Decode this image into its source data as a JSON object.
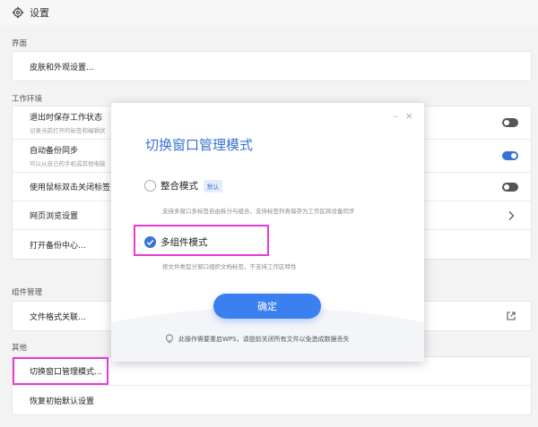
{
  "titlebar": {
    "title": "设置",
    "icon": "gear-icon"
  },
  "sections": {
    "interface": "界面",
    "workspace": "工作环境",
    "components": "组件管理",
    "other": "其他"
  },
  "interface_rows": [
    {
      "label": "皮肤和外观设置..."
    }
  ],
  "workspace_rows": [
    {
      "label": "退出时保存工作状态",
      "sub": "记录当前打开的标签和编辑状",
      "toggle": "off"
    },
    {
      "label": "自动备份同步",
      "sub": "可以从自己的手机或其他电脑",
      "toggle": "on"
    },
    {
      "label": "使用鼠标双击关闭标签",
      "toggle": "off"
    },
    {
      "label": "网页浏览设置",
      "icon": "chevron-right-icon"
    },
    {
      "label": "打开备份中心..."
    }
  ],
  "component_rows": [
    {
      "label": "文件格式关联...",
      "icon": "external-link-icon"
    }
  ],
  "other_rows": [
    {
      "label": "切换窗口管理模式..."
    },
    {
      "label": "恢复初始默认设置"
    }
  ],
  "modal": {
    "title": "切换窗口管理模式",
    "controls": {
      "minimize": "–",
      "close": "×"
    },
    "options": [
      {
        "name": "整合模式",
        "badge": "默认",
        "desc": "支持多窗口多标签自由拆分与组合，支持标签列表保存为工作区跨设备同步",
        "checked": false
      },
      {
        "name": "多组件模式",
        "desc": "按文件类型分窗口组织文档标签，不支持工作区特性",
        "checked": true
      }
    ],
    "confirm": "确定",
    "notice": "此操作需要重启WPS，请提前关闭所有文件以免造成数据丢失"
  },
  "colors": {
    "accent": "#3a73d6",
    "highlight": "#e63ad9",
    "button": "#3a80f0"
  }
}
